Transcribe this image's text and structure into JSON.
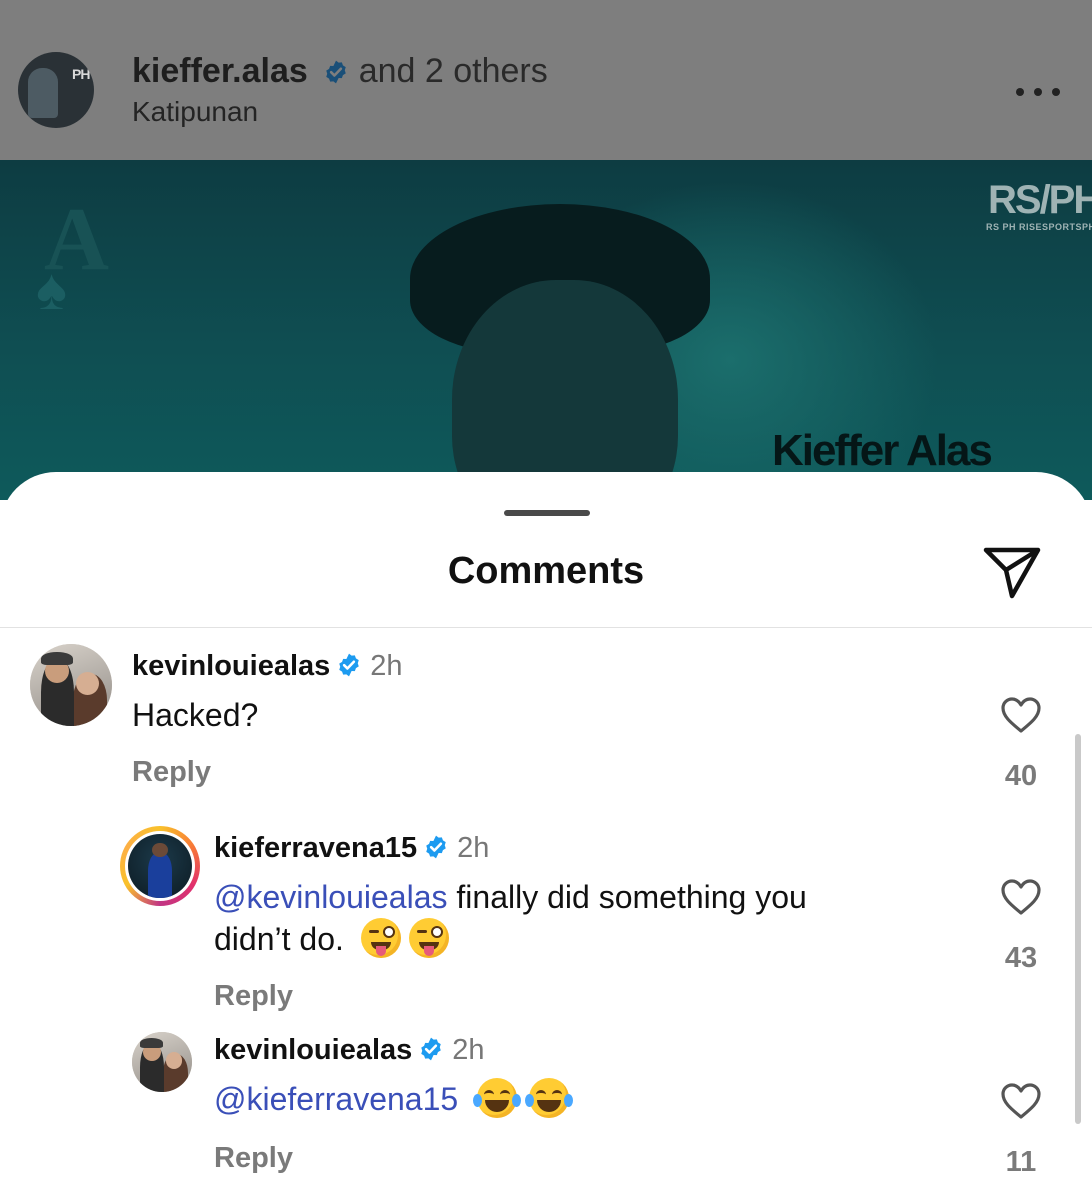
{
  "post": {
    "username": "kieffer.alas",
    "others": "and 2 others",
    "location": "Katipunan",
    "more_icon": "more-horizontal-icon",
    "image": {
      "logo": "RS/PH",
      "logo_sub": "RS PH RISESPORTSPH",
      "name_caption": "Kieffer Alas"
    }
  },
  "sheet": {
    "title": "Comments",
    "share_icon": "send-icon"
  },
  "comments": [
    {
      "username": "kevinlouiealas",
      "verified": true,
      "time": "2h",
      "text": "Hacked?",
      "reply_label": "Reply",
      "likes": "40"
    },
    {
      "username": "kieferravena15",
      "verified": true,
      "time": "2h",
      "mention": "@kevinlouiealas",
      "text_line1": " finally did something you",
      "text_line2": "didn’t do.",
      "emoji": "winking-face-with-tongue",
      "reply_label": "Reply",
      "likes": "43"
    },
    {
      "username": "kevinlouiealas",
      "verified": true,
      "time": "2h",
      "mention": "@kieferravena15",
      "emoji": "face-with-tears-of-joy",
      "reply_label": "Reply",
      "likes": "11"
    }
  ],
  "colors": {
    "mention": "#3a4fb8",
    "verified": "#1d9bf0",
    "muted": "#7a7a7a"
  }
}
